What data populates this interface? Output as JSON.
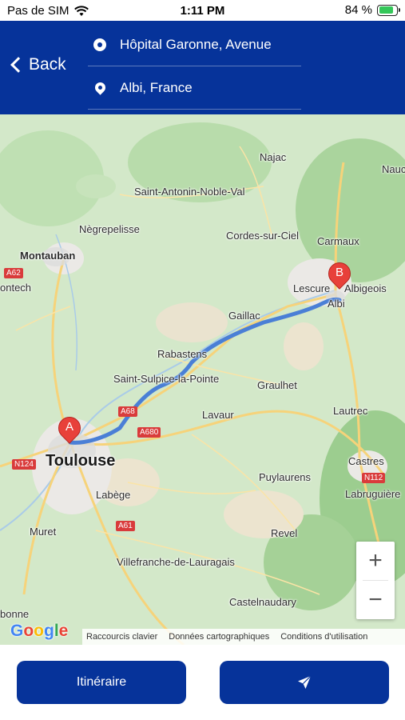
{
  "status_bar": {
    "carrier": "Pas de SIM",
    "time": "1:11 PM",
    "battery": "84 %"
  },
  "header": {
    "back_label": "Back",
    "origin": "Hôpital Garonne, Avenue",
    "destination": "Albi, France",
    "background_color": "#06339a"
  },
  "map": {
    "places": {
      "najac": "Najac",
      "nau": "Nauc",
      "saint_antonin": "Saint-Antonin-Noble-Val",
      "negrepelisse": "Nègrepelisse",
      "cordes": "Cordes-sur-Ciel",
      "carmaux": "Carmaux",
      "montauban": "Montauban",
      "ontech": "ontech",
      "lescure": "Lescure",
      "albigeois": "Albigeois",
      "albi": "Albi",
      "gaillac": "Gaillac",
      "rabastens": "Rabastens",
      "saint_sulpice": "Saint-Sulpice-la-Pointe",
      "graulhet": "Graulhet",
      "lautrec": "Lautrec",
      "lavaur": "Lavaur",
      "toulouse": "Toulouse",
      "castres": "Castres",
      "puylaurens": "Puylaurens",
      "labruguiere": "Labruguière",
      "labege": "Labège",
      "muret": "Muret",
      "revel": "Revel",
      "villefranche": "Villefranche-de-Lauragais",
      "castelnaudary": "Castelnaudary",
      "bonne": "bonne"
    },
    "road_shields": {
      "a62": "A62",
      "a68": "A68",
      "a680": "A680",
      "n124": "N124",
      "n112": "N112",
      "a61": "A61"
    },
    "markers": {
      "start": "A",
      "end": "B"
    },
    "route_color": "#4a7fd6",
    "zoom_in": "+",
    "zoom_out": "−",
    "google_logo": "Google",
    "attribution": {
      "shortcuts": "Raccourcis clavier",
      "map_data": "Données cartographiques",
      "terms": "Conditions d'utilisation"
    }
  },
  "actions": {
    "itinerary_label": "Itinéraire",
    "send_icon": "paper-plane-icon"
  }
}
